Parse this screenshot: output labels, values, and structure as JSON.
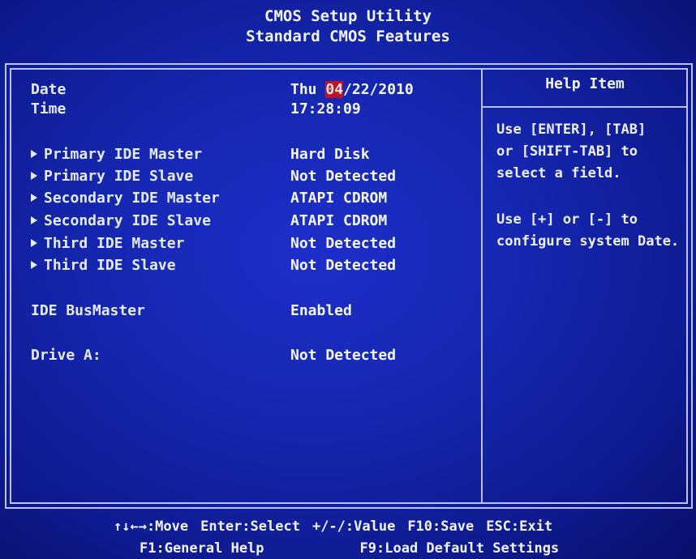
{
  "header": {
    "title": "CMOS Setup Utility",
    "subtitle": "Standard CMOS Features"
  },
  "settings": [
    {
      "label": "Date",
      "value_prefix": "Thu ",
      "value_highlight": "04",
      "value_suffix": "/22/2010",
      "has_submenu": false
    },
    {
      "label": "Time",
      "value": "17:28:09",
      "has_submenu": false
    },
    {
      "label": "Primary IDE Master",
      "value": "Hard Disk",
      "has_submenu": true
    },
    {
      "label": "Primary IDE Slave",
      "value": "Not Detected",
      "has_submenu": true
    },
    {
      "label": "Secondary IDE Master",
      "value": "ATAPI CDROM",
      "has_submenu": true
    },
    {
      "label": "Secondary IDE Slave",
      "value": "ATAPI CDROM",
      "has_submenu": true
    },
    {
      "label": "Third IDE Master",
      "value": "Not Detected",
      "has_submenu": true
    },
    {
      "label": "Third IDE Slave",
      "value": "Not Detected",
      "has_submenu": true
    },
    {
      "label": "IDE BusMaster",
      "value": "Enabled",
      "has_submenu": false
    },
    {
      "label": "Drive A:",
      "value": "Not Detected",
      "has_submenu": false
    }
  ],
  "help": {
    "title": "Help Item",
    "lines": [
      "Use [ENTER], [TAB]",
      "or [SHIFT-TAB] to",
      "select a field.",
      "",
      "Use [+] or [-] to",
      "configure system Date."
    ]
  },
  "footer": {
    "move": "↑↓←→:Move",
    "select": "Enter:Select",
    "value": "+/-/:Value",
    "save": "F10:Save",
    "exit": "ESC:Exit",
    "help": "F1:General Help",
    "defaults": "F9:Load Default Settings"
  },
  "colors": {
    "background": "#1527b0",
    "text": "#e6eaff",
    "highlight": "#c0102a",
    "border": "#b9c2ff"
  }
}
